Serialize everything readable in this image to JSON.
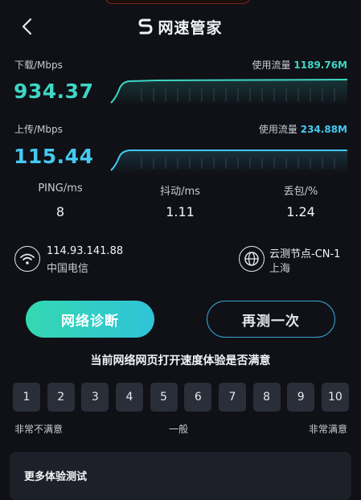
{
  "header": {
    "title": "网速管家",
    "back_icon": "chevron-left-icon",
    "logo_icon": "s-logo-icon"
  },
  "download": {
    "label": "下载/Mbps",
    "usage_label": "使用流量",
    "usage_value": "1189.76M",
    "speed": "934.37",
    "color": "#3fd6c4"
  },
  "upload": {
    "label": "上传/Mbps",
    "usage_label": "使用流量",
    "usage_value": "234.88M",
    "speed": "115.44",
    "color": "#46c9f0"
  },
  "metrics": [
    {
      "label": "PING/ms",
      "value": "8"
    },
    {
      "label": "抖动/ms",
      "value": "1.11"
    },
    {
      "label": "丢包/%",
      "value": "1.24"
    }
  ],
  "network": {
    "ip": "114.93.141.88",
    "isp": "中国电信",
    "icon": "wifi-icon"
  },
  "node": {
    "name": "云测节点-CN-1",
    "city": "上海",
    "icon": "globe-icon"
  },
  "buttons": {
    "diagnose": "网络诊断",
    "retest": "再测一次"
  },
  "survey": {
    "question": "当前网络网页打开速度体验是否满意",
    "ratings": [
      "1",
      "2",
      "3",
      "4",
      "5",
      "6",
      "7",
      "8",
      "9",
      "10"
    ],
    "low_label": "非常不满意",
    "mid_label": "一般",
    "high_label": "非常满意"
  },
  "more": {
    "title": "更多体验测试"
  }
}
